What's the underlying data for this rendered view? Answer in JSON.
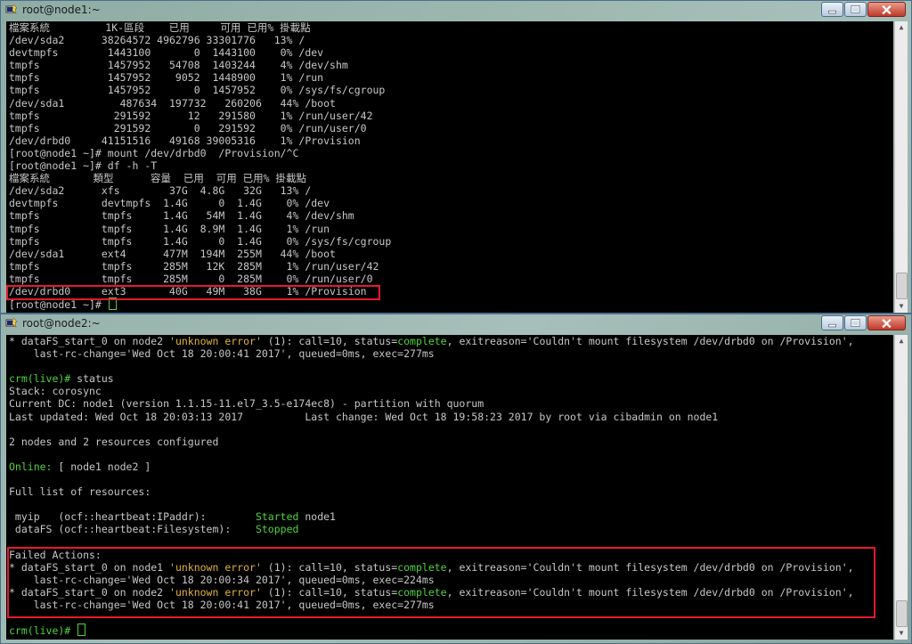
{
  "windows": [
    {
      "title": "root@node1:~",
      "prompt_tail": "[root@node1 ~]# ",
      "lines": [
        {
          "segs": [
            {
              "t": "檔案系統         1K-區段    已用     可用 已用% 掛載點"
            }
          ]
        },
        {
          "segs": [
            {
              "t": "/dev/sda2      38264572 4962796 33301776   13% /"
            }
          ]
        },
        {
          "segs": [
            {
              "t": "devtmpfs        1443100       0  1443100    0% /dev"
            }
          ]
        },
        {
          "segs": [
            {
              "t": "tmpfs           1457952   54708  1403244    4% /dev/shm"
            }
          ]
        },
        {
          "segs": [
            {
              "t": "tmpfs           1457952    9052  1448900    1% /run"
            }
          ]
        },
        {
          "segs": [
            {
              "t": "tmpfs           1457952       0  1457952    0% /sys/fs/cgroup"
            }
          ]
        },
        {
          "segs": [
            {
              "t": "/dev/sda1         487634  197732   260206   44% /boot"
            }
          ]
        },
        {
          "segs": [
            {
              "t": "tmpfs            291592      12   291580    1% /run/user/42"
            }
          ]
        },
        {
          "segs": [
            {
              "t": "tmpfs            291592       0   291592    0% /run/user/0"
            }
          ]
        },
        {
          "segs": [
            {
              "t": "/dev/drbd0     41151516   49168 39005316    1% /Provision"
            }
          ]
        },
        {
          "segs": [
            {
              "t": "[root@node1 ~]# mount /dev/drbd0  /Provision/^C"
            }
          ]
        },
        {
          "segs": [
            {
              "t": "[root@node1 ~]# df -h -T"
            }
          ]
        },
        {
          "segs": [
            {
              "t": "檔案系統       類型      容量  已用  可用 已用% 掛載點"
            }
          ]
        },
        {
          "segs": [
            {
              "t": "/dev/sda2      xfs        37G  4.8G   32G   13% /"
            }
          ]
        },
        {
          "segs": [
            {
              "t": "devtmpfs       devtmpfs  1.4G     0  1.4G    0% /dev"
            }
          ]
        },
        {
          "segs": [
            {
              "t": "tmpfs          tmpfs     1.4G   54M  1.4G    4% /dev/shm"
            }
          ]
        },
        {
          "segs": [
            {
              "t": "tmpfs          tmpfs     1.4G  8.9M  1.4G    1% /run"
            }
          ]
        },
        {
          "segs": [
            {
              "t": "tmpfs          tmpfs     1.4G     0  1.4G    0% /sys/fs/cgroup"
            }
          ]
        },
        {
          "segs": [
            {
              "t": "/dev/sda1      ext4      477M  194M  255M   44% /boot"
            }
          ]
        },
        {
          "segs": [
            {
              "t": "tmpfs          tmpfs     285M   12K  285M    1% /run/user/42"
            }
          ]
        },
        {
          "segs": [
            {
              "t": "tmpfs          tmpfs     285M     0  285M    0% /run/user/0"
            }
          ]
        },
        {
          "segs": [
            {
              "t": "/dev/drbd0     ext3       40G   49M   38G    1% /Provision"
            }
          ]
        }
      ]
    },
    {
      "title": "root@node2:~",
      "prompt_tail": "crm(live)# ",
      "lines": [
        {
          "segs": [
            {
              "t": "* dataFS_start_0 on node2 "
            },
            {
              "t": "'unknown error'",
              "c": "y"
            },
            {
              "t": " (1): call=10, status="
            },
            {
              "t": "complete",
              "c": "g"
            },
            {
              "t": ", exitreason='Couldn't mount filesystem /dev/drbd0 on /Provision',"
            }
          ]
        },
        {
          "segs": [
            {
              "t": "    last-rc-change='Wed Oct 18 20:00:41 2017', queued=0ms, exec=277ms"
            }
          ]
        },
        {
          "segs": [
            {
              "t": ""
            }
          ]
        },
        {
          "segs": [
            {
              "t": "crm(live)# ",
              "c": "g"
            },
            {
              "t": "status"
            }
          ]
        },
        {
          "segs": [
            {
              "t": "Stack: corosync"
            }
          ]
        },
        {
          "segs": [
            {
              "t": "Current DC: node1 (version 1.1.15-11.el7_3.5-e174ec8) - partition with quorum"
            }
          ]
        },
        {
          "segs": [
            {
              "t": "Last updated: Wed Oct 18 20:03:13 2017          Last change: Wed Oct 18 19:58:23 2017 by root via cibadmin on node1"
            }
          ]
        },
        {
          "segs": [
            {
              "t": ""
            }
          ]
        },
        {
          "segs": [
            {
              "t": "2 nodes and 2 resources configured"
            }
          ]
        },
        {
          "segs": [
            {
              "t": ""
            }
          ]
        },
        {
          "segs": [
            {
              "t": "Online:",
              "c": "g"
            },
            {
              "t": " [ node1 node2 ]"
            }
          ]
        },
        {
          "segs": [
            {
              "t": ""
            }
          ]
        },
        {
          "segs": [
            {
              "t": "Full list of resources:"
            }
          ]
        },
        {
          "segs": [
            {
              "t": ""
            }
          ]
        },
        {
          "segs": [
            {
              "t": " myip   (ocf::heartbeat:IPaddr):        "
            },
            {
              "t": "Started",
              "c": "g"
            },
            {
              "t": " node1"
            }
          ]
        },
        {
          "segs": [
            {
              "t": " dataFS (ocf::heartbeat:Filesystem):    "
            },
            {
              "t": "Stopped",
              "c": "g"
            }
          ]
        },
        {
          "segs": [
            {
              "t": ""
            }
          ]
        },
        {
          "segs": [
            {
              "t": "Failed Actions:"
            }
          ]
        },
        {
          "segs": [
            {
              "t": "* dataFS_start_0 on node1 "
            },
            {
              "t": "'unknown error'",
              "c": "y"
            },
            {
              "t": " (1): call=10, status="
            },
            {
              "t": "complete",
              "c": "g"
            },
            {
              "t": ", exitreason='Couldn't mount filesystem /dev/drbd0 on /Provision',"
            }
          ]
        },
        {
          "segs": [
            {
              "t": "    last-rc-change='Wed Oct 18 20:00:34 2017', queued=0ms, exec=224ms"
            }
          ]
        },
        {
          "segs": [
            {
              "t": "* dataFS_start_0 on node2 "
            },
            {
              "t": "'unknown error'",
              "c": "y"
            },
            {
              "t": " (1): call=10, status="
            },
            {
              "t": "complete",
              "c": "g"
            },
            {
              "t": ", exitreason='Couldn't mount filesystem /dev/drbd0 on /Provision',"
            }
          ]
        },
        {
          "segs": [
            {
              "t": "    last-rc-change='Wed Oct 18 20:00:41 2017', queued=0ms, exec=277ms"
            }
          ]
        },
        {
          "segs": [
            {
              "t": ""
            }
          ]
        }
      ]
    }
  ],
  "icons": {
    "app": "putty-icon",
    "minimize": "minimize-icon",
    "maximize": "maximize-icon",
    "close": "close-icon"
  },
  "colors": {
    "highlight": "#e8192b",
    "ok_text": "#4fd43c",
    "warn_text": "#e0b23a",
    "terminal_fg": "#c7c7c7",
    "terminal_bg": "#000000"
  }
}
